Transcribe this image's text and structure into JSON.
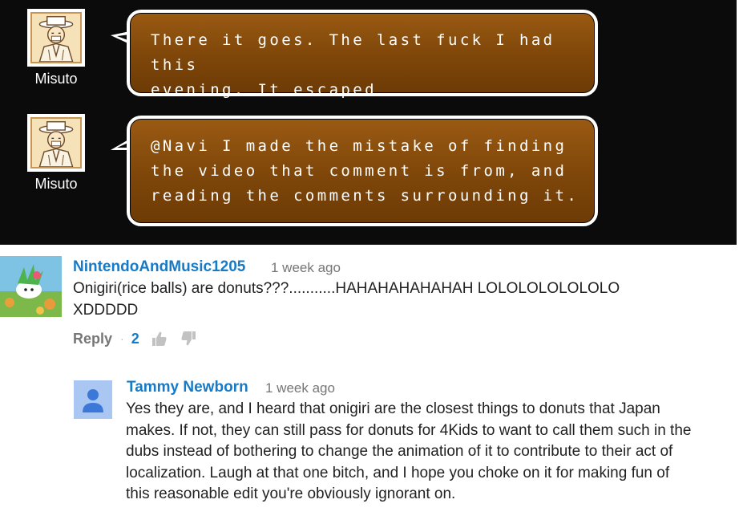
{
  "chat": {
    "messages": [
      {
        "user": "Misuto",
        "text": "There it goes. The last fuck I had this\nevening. It escaped"
      },
      {
        "user": "Misuto",
        "text": "@Navi I made the mistake of finding\nthe video that comment is from, and\nreading the comments surrounding it."
      }
    ]
  },
  "comment": {
    "author": "NintendoAndMusic1205",
    "time": "1 week ago",
    "text_line1": "Onigiri(rice balls) are donuts???...........HAHAHAHAHAHAH LOLOLOLOLOLOLO",
    "text_line2": "XDDDDD",
    "reply_label": "Reply",
    "dot": "·",
    "like_count": "2",
    "like_icon": "thumbs-up-icon",
    "dislike_icon": "thumbs-down-icon"
  },
  "reply": {
    "author": "Tammy Newborn",
    "time": "1 week ago",
    "lines": [
      "Yes they are, and I heard that onigiri are the closest things to donuts that Japan",
      "makes. If not, they can still pass for donuts for 4Kids to want to call them such in the",
      "dubs instead of bothering to change the animation of it to contribute to their act of",
      "localization. Laugh at that one bitch, and I hope you choke on it for making fun of",
      "this reasonable edit you're obviously ignorant on."
    ]
  },
  "colors": {
    "link_blue": "#167ac6",
    "bubble_brown": "#7e4609",
    "chat_background": "#0b0b0b"
  }
}
